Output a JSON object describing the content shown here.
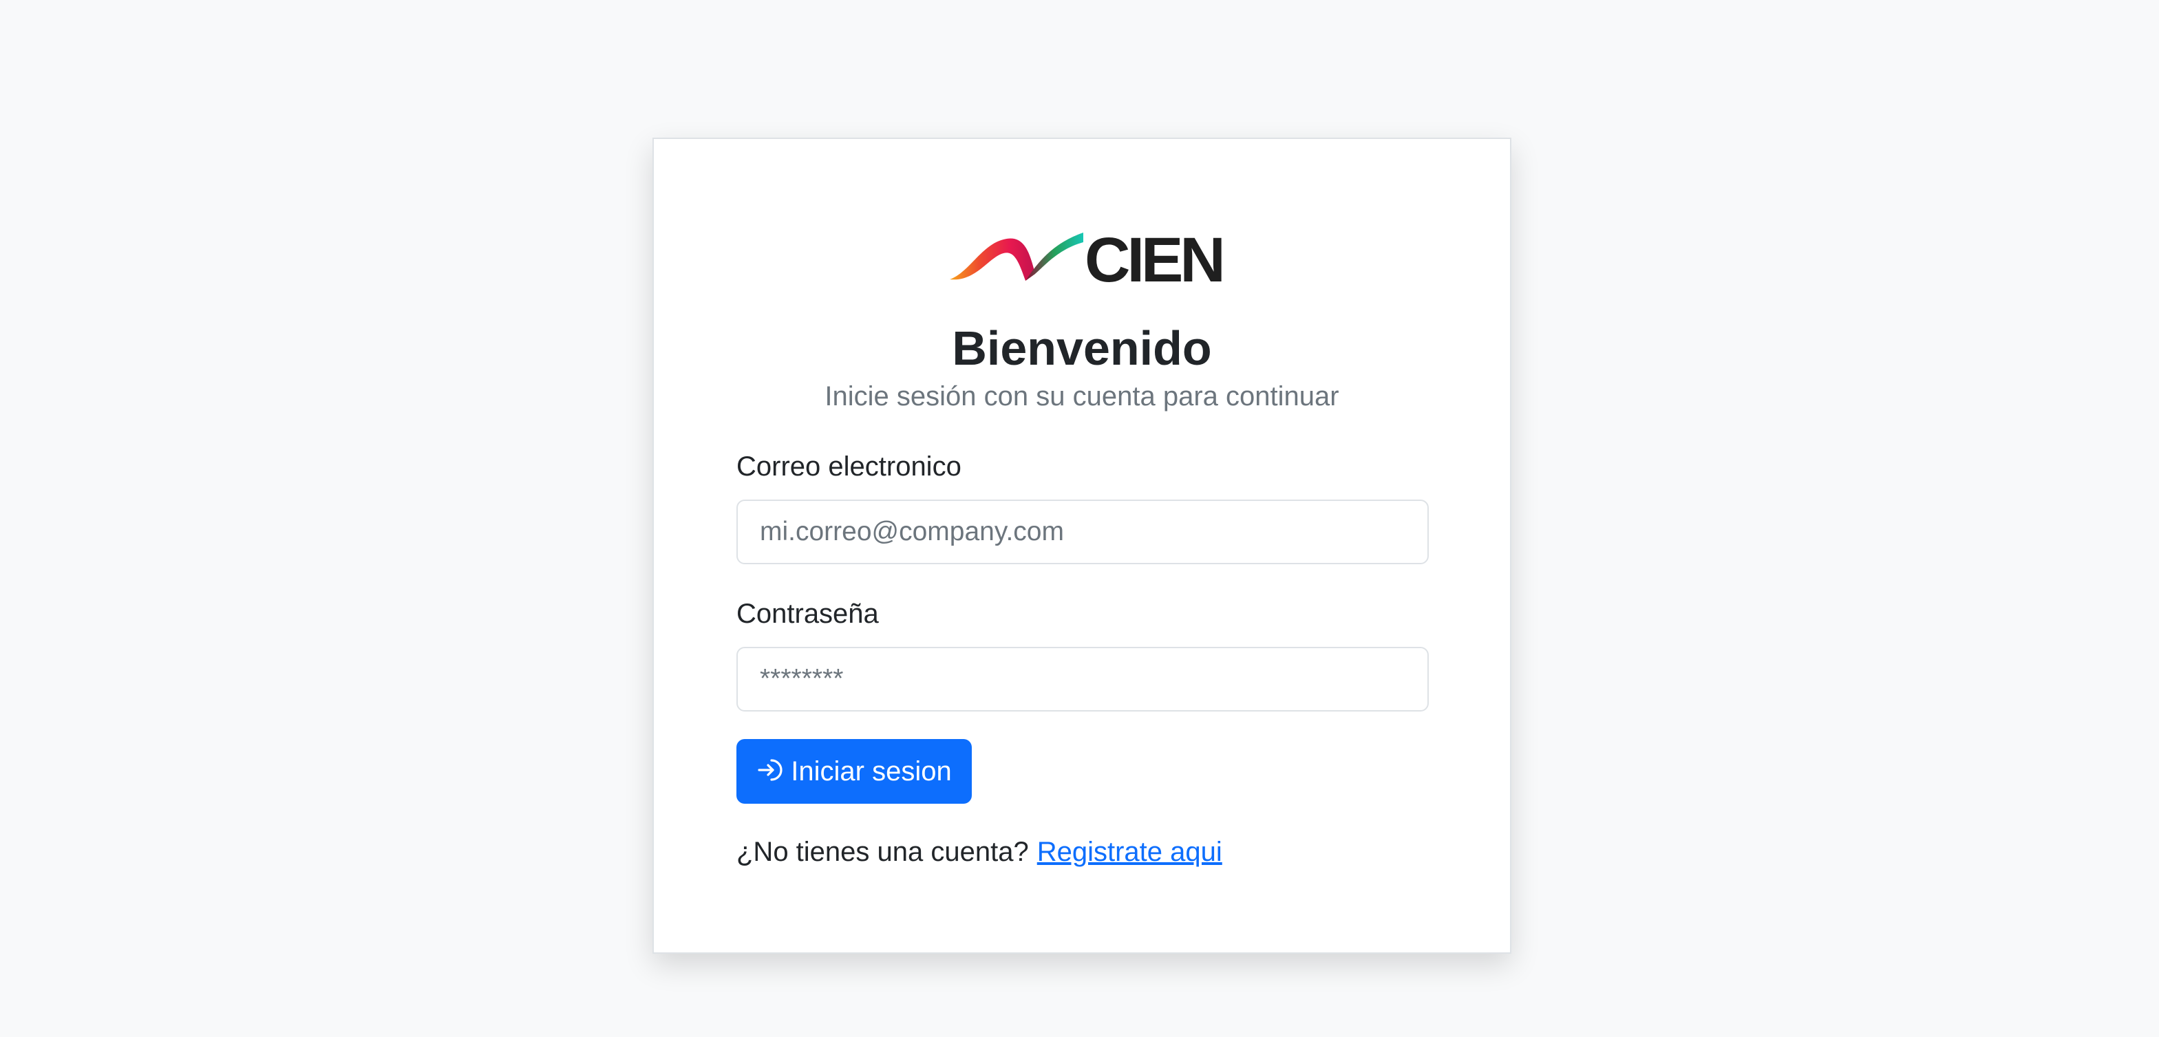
{
  "brand": {
    "logo_text": "CIEN"
  },
  "login": {
    "title": "Bienvenido",
    "subtitle": "Inicie sesión con su cuenta para continuar",
    "email": {
      "label": "Correo electronico",
      "placeholder": "mi.correo@company.com",
      "value": ""
    },
    "password": {
      "label": "Contraseña",
      "placeholder": "********",
      "value": ""
    },
    "submit_label": "Iniciar sesion",
    "register_prompt": "¿No tienes una cuenta?",
    "register_link": "Registrate aqui"
  },
  "icons": {
    "submit": "login-arrow-icon"
  },
  "colors": {
    "page_background": "#f8f9fa",
    "primary": "#0d6efd",
    "text": "#212529",
    "muted": "#6c757d",
    "border": "#dee2e6"
  }
}
